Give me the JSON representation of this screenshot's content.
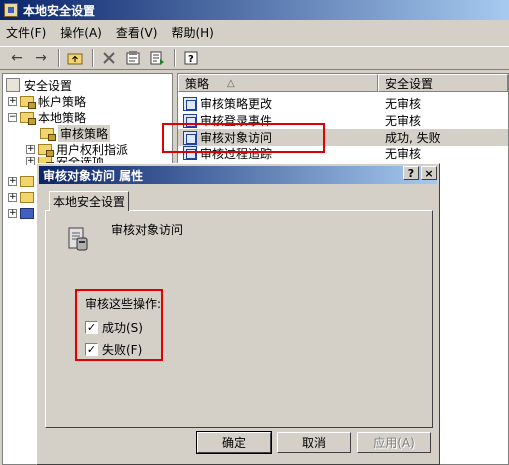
{
  "window": {
    "title": "本地安全设置"
  },
  "menu": [
    "文件(F)",
    "操作(A)",
    "查看(V)",
    "帮助(H)"
  ],
  "toolbar": {
    "icons": [
      "back-arrow-icon",
      "forward-arrow-icon",
      "up-folder-icon",
      "delete-icon",
      "properties-icon",
      "export-list-icon",
      "help-icon"
    ]
  },
  "tree": {
    "root": "安全设置",
    "account_policy": "帐户策略",
    "local_policy": "本地策略",
    "audit_policy": "审核策略",
    "user_rights": "用户权利指派",
    "security_options": "安全选项"
  },
  "list": {
    "col_policy": "策略",
    "col_setting": "安全设置",
    "sort_indicator": "△",
    "rows": [
      {
        "name": "审核策略更改",
        "setting": "无审核"
      },
      {
        "name": "审核登录事件",
        "setting": "无审核"
      },
      {
        "name": "审核对象访问",
        "setting": "成功, 失败"
      },
      {
        "name": "审核过程追踪",
        "setting": "无审核"
      }
    ]
  },
  "dialog": {
    "title": "审核对象访问 属性",
    "help_btn": "?",
    "close_btn": "×",
    "tab": "本地安全设置",
    "policy_name": "审核对象访问",
    "group_label": "审核这些操作:",
    "success_label": "成功(S)",
    "failure_label": "失败(F)",
    "success_checked": true,
    "failure_checked": true,
    "ok": "确定",
    "cancel": "取消",
    "apply": "应用(A)"
  },
  "colors": {
    "highlight_box": "#e00000",
    "title_gradient_start": "#0a246a"
  }
}
